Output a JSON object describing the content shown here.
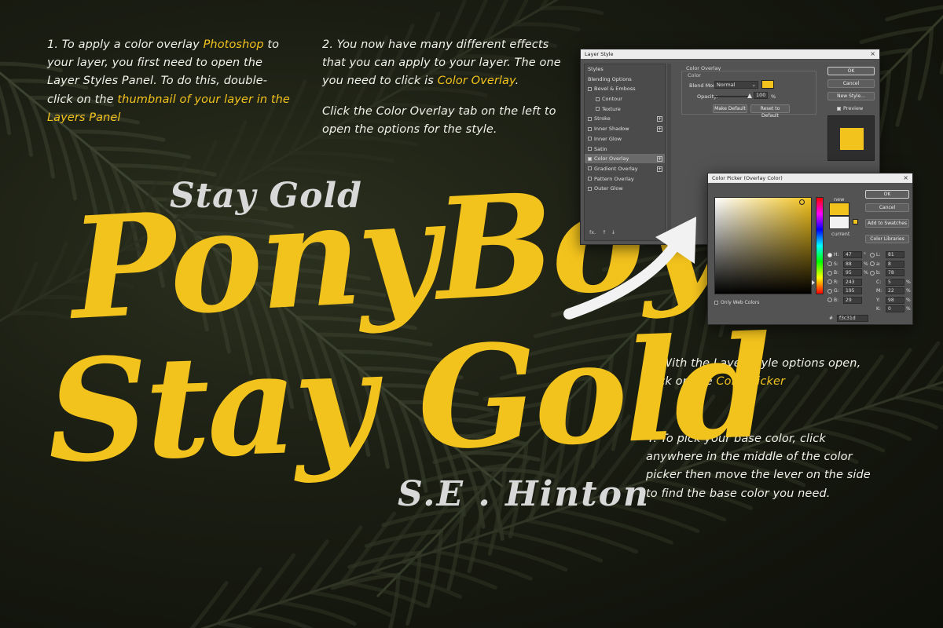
{
  "colors": {
    "accent": "#f3c31d",
    "text": "#f1f1ea",
    "silver": "#d8d8d8"
  },
  "steps": {
    "s1": {
      "a": "1. To apply a color overlay ",
      "b": "Photoshop",
      "c": " to your layer, you first need to open the Layer Styles Panel. To do this, double-click on the ",
      "d": "thumbnail of your layer in the Layers Panel"
    },
    "s2": {
      "a": "2. You now have many different effects that you can apply to your layer. The one you need to click is ",
      "b": "Color Overlay",
      "c": ".",
      "d": "Click the Color Overlay tab on the left to open the options for the style."
    },
    "s3": {
      "a": "3. With the Layer Style options open, click on the ",
      "b": "Color Picker"
    },
    "s4": {
      "a": "4. To pick your base color, click anywhere in the middle of the color picker then move the lever on the side to find the base color you need."
    }
  },
  "showcase": {
    "small_top": "Stay Gold",
    "line1": "PonyBoy",
    "line2": "Stay Gold",
    "author": "S.E . Hinton"
  },
  "layer_style": {
    "title": "Layer Style",
    "styles_header": "Styles",
    "items": [
      {
        "label": "Blending Options",
        "checkbox": false,
        "checked": false,
        "plus": false,
        "indent": false,
        "selected": false
      },
      {
        "label": "Bevel & Emboss",
        "checkbox": true,
        "checked": false,
        "plus": false,
        "indent": false,
        "selected": false
      },
      {
        "label": "Contour",
        "checkbox": true,
        "checked": false,
        "plus": false,
        "indent": true,
        "selected": false
      },
      {
        "label": "Texture",
        "checkbox": true,
        "checked": false,
        "plus": false,
        "indent": true,
        "selected": false
      },
      {
        "label": "Stroke",
        "checkbox": true,
        "checked": false,
        "plus": true,
        "indent": false,
        "selected": false
      },
      {
        "label": "Inner Shadow",
        "checkbox": true,
        "checked": false,
        "plus": true,
        "indent": false,
        "selected": false
      },
      {
        "label": "Inner Glow",
        "checkbox": true,
        "checked": false,
        "plus": false,
        "indent": false,
        "selected": false
      },
      {
        "label": "Satin",
        "checkbox": true,
        "checked": false,
        "plus": false,
        "indent": false,
        "selected": false
      },
      {
        "label": "Color Overlay",
        "checkbox": true,
        "checked": true,
        "plus": true,
        "indent": false,
        "selected": true
      },
      {
        "label": "Gradient Overlay",
        "checkbox": true,
        "checked": false,
        "plus": true,
        "indent": false,
        "selected": false
      },
      {
        "label": "Pattern Overlay",
        "checkbox": true,
        "checked": false,
        "plus": false,
        "indent": false,
        "selected": false
      },
      {
        "label": "Outer Glow",
        "checkbox": true,
        "checked": false,
        "plus": false,
        "indent": false,
        "selected": false
      }
    ],
    "fx_label": "fx.",
    "section_title": "Color Overlay",
    "sub_title": "Color",
    "blend_mode_label": "Blend Mode:",
    "blend_mode_value": "Normal",
    "opacity_label": "Opacity:",
    "opacity_value": "100",
    "opacity_unit": "%",
    "overlay_color": "#f3c31d",
    "make_default": "Make Default",
    "reset_default": "Reset to Default",
    "ok": "OK",
    "cancel": "Cancel",
    "new_style": "New Style...",
    "preview": "Preview"
  },
  "color_picker": {
    "title": "Color Picker (Overlay Color)",
    "new_label": "new",
    "current_label": "current",
    "ok": "OK",
    "cancel": "Cancel",
    "add_swatches": "Add to Swatches",
    "color_libraries": "Color Libraries",
    "only_web": "Only Web Colors",
    "hex_prefix": "#",
    "hex": "f3c31d",
    "new_color": "#f3c31d",
    "current_color": "#f2f2f2",
    "hue_level": 0.12,
    "left_fields": [
      {
        "label": "H:",
        "value": "47",
        "unit": "°",
        "radio": true,
        "on": true
      },
      {
        "label": "S:",
        "value": "88",
        "unit": "%",
        "radio": true,
        "on": false
      },
      {
        "label": "B:",
        "value": "95",
        "unit": "%",
        "radio": true,
        "on": false
      },
      {
        "label": "R:",
        "value": "243",
        "unit": "",
        "radio": true,
        "on": false
      },
      {
        "label": "G:",
        "value": "195",
        "unit": "",
        "radio": true,
        "on": false
      },
      {
        "label": "B:",
        "value": "29",
        "unit": "",
        "radio": true,
        "on": false
      }
    ],
    "right_fields": [
      {
        "label": "L:",
        "value": "81",
        "unit": "",
        "radio": true,
        "on": false
      },
      {
        "label": "a:",
        "value": "8",
        "unit": "",
        "radio": true,
        "on": false
      },
      {
        "label": "b:",
        "value": "78",
        "unit": "",
        "radio": true,
        "on": false
      },
      {
        "label": "C:",
        "value": "5",
        "unit": "%",
        "radio": false,
        "on": false
      },
      {
        "label": "M:",
        "value": "22",
        "unit": "%",
        "radio": false,
        "on": false
      },
      {
        "label": "Y:",
        "value": "98",
        "unit": "%",
        "radio": false,
        "on": false
      },
      {
        "label": "K:",
        "value": "0",
        "unit": "%",
        "radio": false,
        "on": false
      }
    ]
  }
}
